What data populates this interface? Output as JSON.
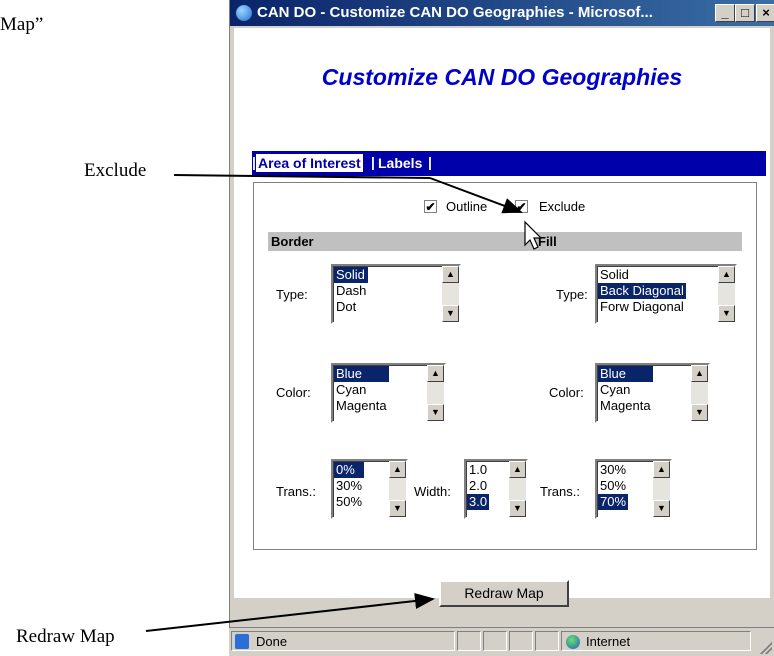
{
  "annotations": {
    "top_left_quote": "Map”",
    "exclude_label": "Exclude",
    "redraw_label": "Redraw Map"
  },
  "window": {
    "title": "CAN DO - Customize CAN DO Geographies - Microsof...",
    "min_glyph": "_",
    "max_glyph": "□",
    "close_glyph": "×"
  },
  "page": {
    "title": "Customize CAN DO Geographies",
    "tabs": {
      "area": "Area of Interest",
      "labels": "Labels",
      "sep": "|"
    }
  },
  "options": {
    "outline": {
      "label": "Outline",
      "checked": true
    },
    "exclude": {
      "label": "Exclude",
      "checked": true
    },
    "check_glyph": "✔"
  },
  "sections": {
    "border": "Border",
    "fill": "Fill"
  },
  "fields": {
    "type_label": "Type:",
    "color_label": "Color:",
    "trans_label": "Trans.:",
    "width_label": "Width:"
  },
  "lists": {
    "border_type": [
      "Solid",
      "Dash",
      "Dot"
    ],
    "fill_type": [
      "Solid",
      "Back Diagonal",
      "Forw Diagonal"
    ],
    "border_color": [
      "Blue",
      "Cyan",
      "Magenta"
    ],
    "fill_color": [
      "Blue",
      "Cyan",
      "Magenta"
    ],
    "border_trans": [
      "0%",
      "30%",
      "50%"
    ],
    "width": [
      "1.0",
      "2.0",
      "3.0"
    ],
    "fill_trans": [
      "30%",
      "50%",
      "70%"
    ]
  },
  "selected": {
    "border_type": "Solid",
    "fill_type": "Back Diagonal",
    "border_color": "Blue",
    "fill_color": "Blue",
    "border_trans": "0%",
    "width": "3.0",
    "fill_trans": "70%"
  },
  "buttons": {
    "redraw": "Redraw Map"
  },
  "scroll": {
    "up": "▲",
    "down": "▼"
  },
  "status": {
    "text": "Done",
    "zone": "Internet"
  },
  "colors": {
    "title_blue": "#0000cc",
    "tab_bar": "#0000aa",
    "selection": "#0a246a"
  }
}
